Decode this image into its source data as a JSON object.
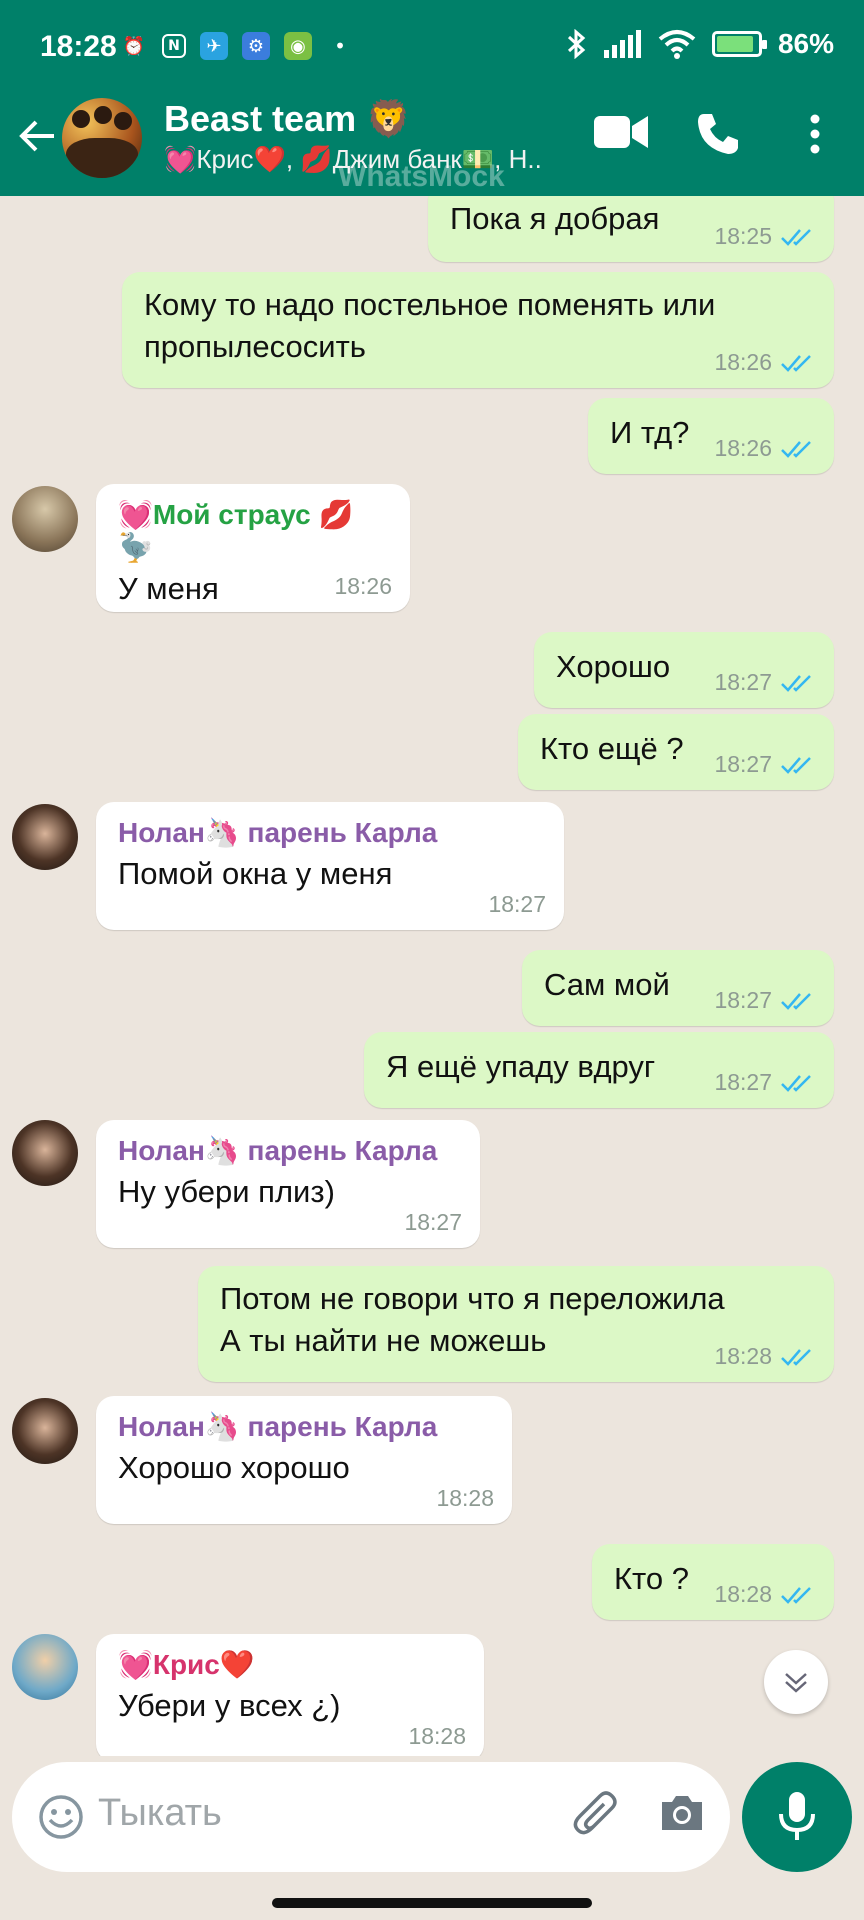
{
  "status_bar": {
    "time": "18:28",
    "battery": "86%",
    "battery_level": 0.86
  },
  "header": {
    "title": "Beast team 🦁",
    "subtitle": "💓Крис❤️, 💋Джим банк💵, Н..",
    "watermark": "WhatsMock"
  },
  "messages": [
    {
      "dir": "out",
      "text": "Пока я добрая",
      "time": "18:25",
      "read": true
    },
    {
      "dir": "out",
      "text": "Кому то надо постельное поменять или\nпропылесосить",
      "time": "18:26",
      "read": true
    },
    {
      "dir": "out",
      "text": "И тд?",
      "time": "18:26",
      "read": true
    },
    {
      "dir": "in",
      "sender": "💓Мой страус 💋🦤",
      "sender_color": "#25a244",
      "text": "У меня",
      "time": "18:26"
    },
    {
      "dir": "out",
      "text": "Хорошо",
      "time": "18:27",
      "read": true
    },
    {
      "dir": "out",
      "text": "Кто ещё ?",
      "time": "18:27",
      "read": true
    },
    {
      "dir": "in",
      "sender": "Нолан🦄 парень Карла",
      "sender_color": "#8a5ca8",
      "text": "Помой окна у меня",
      "time": "18:27"
    },
    {
      "dir": "out",
      "text": "Сам мой",
      "time": "18:27",
      "read": true
    },
    {
      "dir": "out",
      "text": "Я ещё упаду вдруг",
      "time": "18:27",
      "read": true
    },
    {
      "dir": "in",
      "sender": "Нолан🦄 парень Карла",
      "sender_color": "#8a5ca8",
      "text": "Ну убери плиз)",
      "time": "18:27"
    },
    {
      "dir": "out",
      "text": "Потом не говори что я переложила\nА ты найти не можешь",
      "time": "18:28",
      "read": true
    },
    {
      "dir": "in",
      "sender": "Нолан🦄 парень Карла",
      "sender_color": "#8a5ca8",
      "text": "Хорошо хорошо",
      "time": "18:28"
    },
    {
      "dir": "out",
      "text": "Кто ?",
      "time": "18:28",
      "read": true
    },
    {
      "dir": "in",
      "sender": "💓Крис❤️",
      "sender_color": "#d6336c",
      "text": "Убери у всех ¿)",
      "time": "18:28"
    }
  ],
  "input": {
    "placeholder": "Тыкать"
  },
  "colors": {
    "header": "#008069",
    "outgoing": "#dcf8c6",
    "incoming": "#ffffff",
    "tick": "#34b7f1"
  }
}
